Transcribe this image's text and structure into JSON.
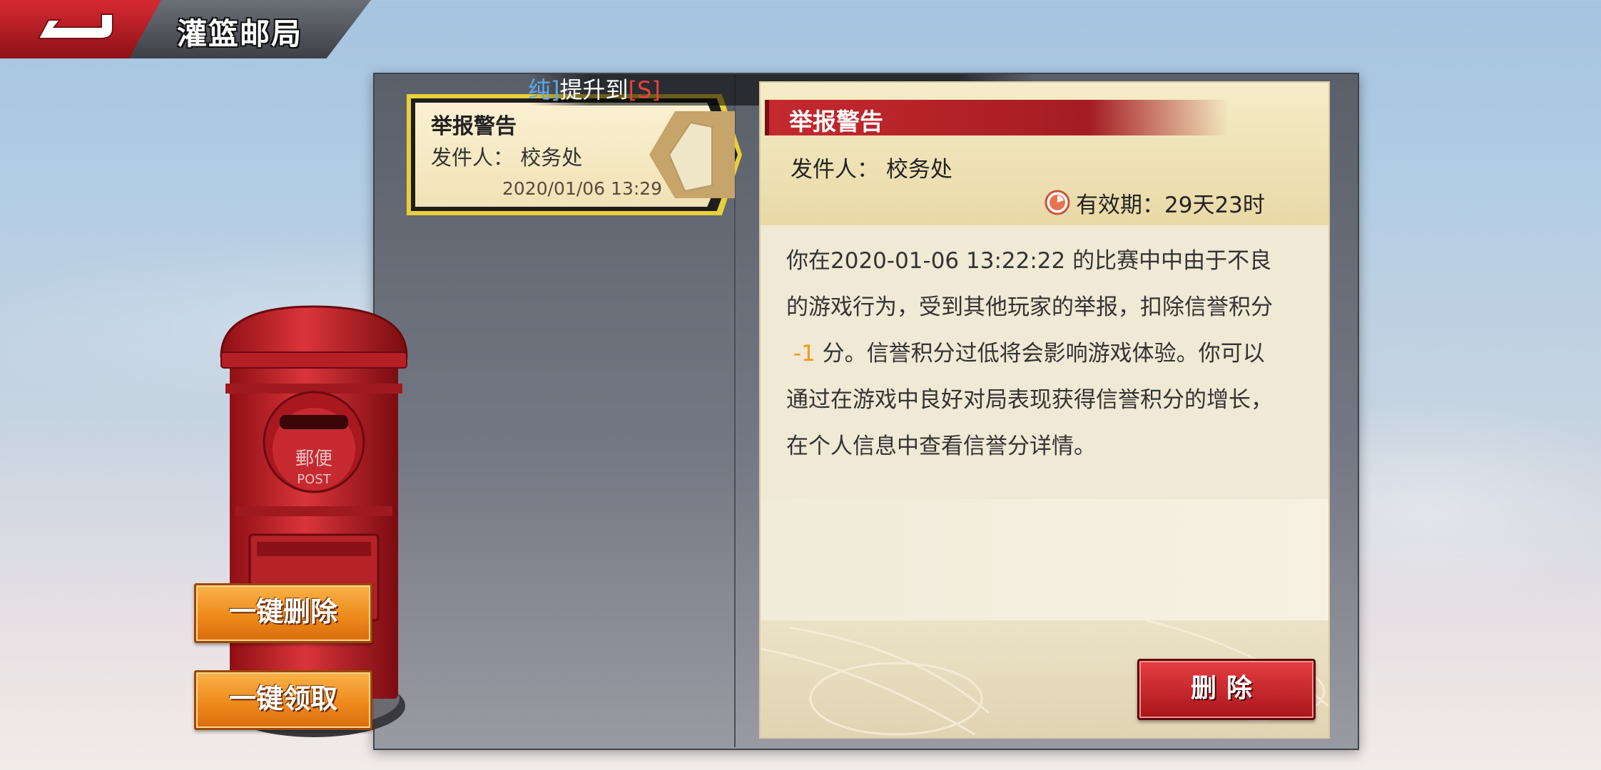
{
  "header": {
    "title": "灌篮邮局"
  },
  "ticker": {
    "part1": "纯]",
    "part2": "提升到",
    "part3": "[S]"
  },
  "mail_list": [
    {
      "title": "举报警告",
      "sender": "发件人： 校务处",
      "date": "2020/01/06 13:29"
    }
  ],
  "detail": {
    "title": "举报警告",
    "sender": "发件人： 校务处",
    "validity": "有效期：29天23时",
    "body_line1": "你在2020-01-06 13:22:22 的比赛中中由于不良",
    "body_line2": "的游戏行为，受到其他玩家的举报，扣除信誉积分",
    "body_penalty": "-1",
    "body_line3_rest": " 分。信誉积分过低将会影响游戏体验。你可以",
    "body_line4": "通过在游戏中良好对局表现获得信誉积分的增长，",
    "body_line5": "在个人信息中查看信誉分详情。",
    "delete_label": "删除"
  },
  "mailbox": {
    "plate_top": "郵便",
    "plate_bottom": "POST"
  },
  "buttons": {
    "delete_all": "一键删除",
    "claim_all": "一键领取"
  },
  "colors": {
    "accent_red": "#c42a2f",
    "accent_orange": "#ef8a1c",
    "penalty": "#f09a1a",
    "highlight_frame": "#e8d03a"
  },
  "icons": {
    "back": "back-arrow-icon",
    "clock": "clock-icon",
    "envelope": "envelope-icon"
  }
}
